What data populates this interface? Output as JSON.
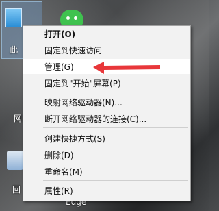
{
  "desktop": {
    "pc_label": "此",
    "network_label": "网",
    "recycle_label": "回",
    "edge_label": "Edge"
  },
  "menu": {
    "items": [
      {
        "label": "打开(O)"
      },
      {
        "label": "固定到快速访问"
      },
      {
        "label": "管理(G)"
      },
      {
        "label": "固定到\"开始\"屏幕(P)"
      },
      {
        "label": "映射网络驱动器(N)..."
      },
      {
        "label": "断开网络驱动器的连接(C)..."
      },
      {
        "label": "创建快捷方式(S)"
      },
      {
        "label": "删除(D)"
      },
      {
        "label": "重命名(M)"
      },
      {
        "label": "属性(R)"
      }
    ]
  },
  "annotation": {
    "arrow_color": "#e8373a"
  },
  "colors": {
    "menu_bg": "#f2f2f2",
    "highlight": "#ffffff"
  }
}
